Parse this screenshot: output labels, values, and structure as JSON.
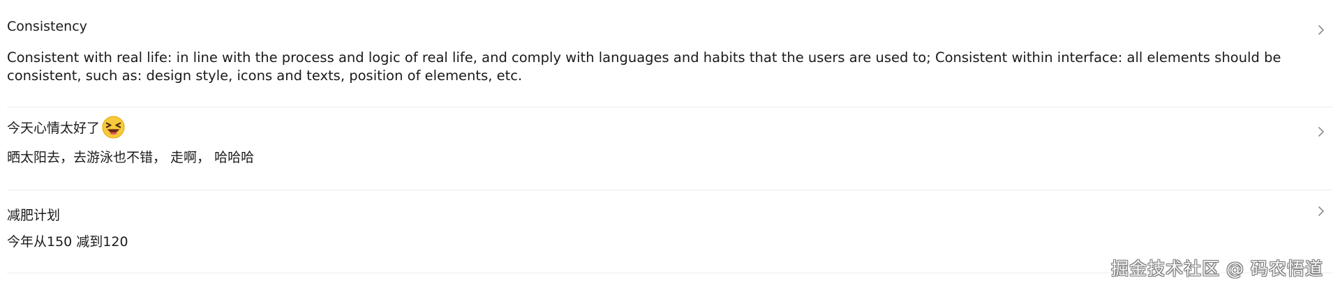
{
  "list": {
    "items": [
      {
        "title": "Consistency",
        "description": "Consistent with real life: in line with the process and logic of real life, and comply with languages and habits that the users are used to; Consistent within interface: all elements should be consistent, such as: design style, icons and texts, position of elements, etc."
      },
      {
        "title": "今天心情太好了",
        "emoji": "laughing-face-icon",
        "description": "晒太阳去，去游泳也不错，  走啊，  哈哈哈"
      },
      {
        "title": "减肥计划",
        "description": "今年从150 减到120"
      }
    ]
  },
  "watermark": "掘金技术社区 @ 码农悟道",
  "colors": {
    "text": "#1a1a1a",
    "divider": "#ececec",
    "chevron": "#8c8c8c",
    "emoji_face": "#f7c93c"
  }
}
